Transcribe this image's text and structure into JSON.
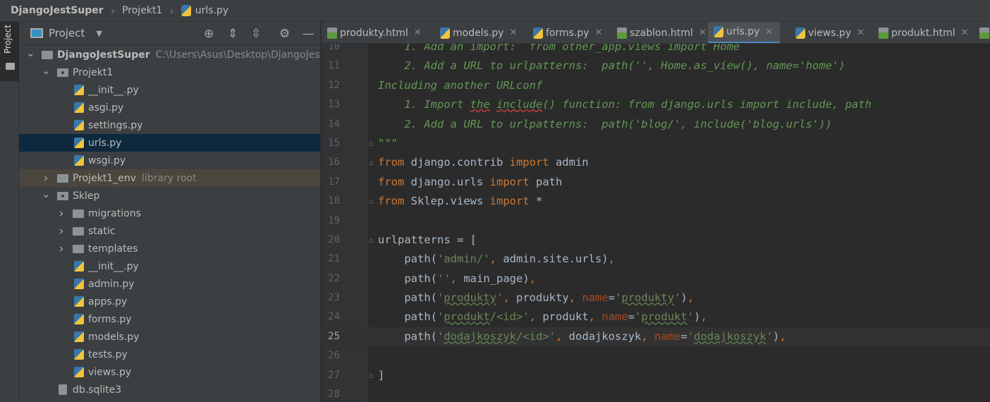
{
  "breadcrumb": [
    "DjangoJestSuper",
    "Projekt1",
    "urls.py"
  ],
  "sidebar_strip": {
    "label": "Project"
  },
  "panel": {
    "title": "Project",
    "toolbar": [
      "locate-icon",
      "expand-all-icon",
      "collapse-all-icon",
      "gear-icon",
      "minimize-icon"
    ]
  },
  "tree": [
    {
      "level": 0,
      "type": "folder",
      "expanded": true,
      "name": "DjangoJestSuper",
      "hint": "C:\\Users\\Asus\\Desktop\\DjangoJestSuper",
      "bold": true
    },
    {
      "level": 1,
      "type": "package",
      "expanded": true,
      "name": "Projekt1"
    },
    {
      "level": 2,
      "type": "py",
      "name": "__init__.py"
    },
    {
      "level": 2,
      "type": "py",
      "name": "asgi.py"
    },
    {
      "level": 2,
      "type": "py",
      "name": "settings.py"
    },
    {
      "level": 2,
      "type": "py",
      "name": "urls.py",
      "selected": true
    },
    {
      "level": 2,
      "type": "py",
      "name": "wsgi.py"
    },
    {
      "level": 1,
      "type": "folder",
      "expanded": false,
      "name": "Projekt1_env",
      "hint": "library root",
      "library": true
    },
    {
      "level": 1,
      "type": "package",
      "expanded": true,
      "name": "Sklep"
    },
    {
      "level": 2,
      "type": "folder",
      "expanded": false,
      "name": "migrations"
    },
    {
      "level": 2,
      "type": "folder",
      "expanded": false,
      "name": "static"
    },
    {
      "level": 2,
      "type": "folder",
      "expanded": false,
      "name": "templates"
    },
    {
      "level": 2,
      "type": "py",
      "name": "__init__.py"
    },
    {
      "level": 2,
      "type": "py",
      "name": "admin.py"
    },
    {
      "level": 2,
      "type": "py",
      "name": "apps.py"
    },
    {
      "level": 2,
      "type": "py",
      "name": "forms.py"
    },
    {
      "level": 2,
      "type": "py",
      "name": "models.py"
    },
    {
      "level": 2,
      "type": "py",
      "name": "tests.py"
    },
    {
      "level": 2,
      "type": "py",
      "name": "views.py"
    },
    {
      "level": 1,
      "type": "db",
      "name": "db.sqlite3"
    }
  ],
  "tabs": [
    {
      "name": "produkty.html",
      "type": "html"
    },
    {
      "name": "models.py",
      "type": "py"
    },
    {
      "name": "forms.py",
      "type": "py"
    },
    {
      "name": "szablon.html",
      "type": "html"
    },
    {
      "name": "urls.py",
      "type": "py",
      "active": true
    },
    {
      "name": "views.py",
      "type": "py"
    },
    {
      "name": "produkt.html",
      "type": "html"
    },
    {
      "name": "",
      "type": "html"
    }
  ],
  "editor": {
    "current_line": 25,
    "lines": [
      {
        "n": 10,
        "tokens": [
          [
            "doc",
            "    1. Add an import:  from other_app.views import Home"
          ]
        ]
      },
      {
        "n": 11,
        "tokens": [
          [
            "doc",
            "    2. Add a URL to urlpatterns:  path('', Home.as_view(), name='home')"
          ]
        ]
      },
      {
        "n": 12,
        "tokens": [
          [
            "doc",
            "Including another URLconf"
          ]
        ]
      },
      {
        "n": 13,
        "tokens": [
          [
            "doc",
            "    1. Import "
          ],
          [
            "doc err",
            "the"
          ],
          [
            "doc",
            " "
          ],
          [
            "doc err",
            "include"
          ],
          [
            "doc",
            "() function: from django.urls import include, path"
          ]
        ]
      },
      {
        "n": 14,
        "tokens": [
          [
            "doc",
            "    2. Add a URL to urlpatterns:  path('blog/', include('blog.urls'))"
          ]
        ]
      },
      {
        "n": 15,
        "fold": true,
        "tokens": [
          [
            "doc",
            "\"\"\""
          ]
        ]
      },
      {
        "n": 16,
        "fold": true,
        "tokens": [
          [
            "kw",
            "from"
          ],
          [
            "plain",
            " django.contrib "
          ],
          [
            "kw",
            "import"
          ],
          [
            "plain",
            " admin"
          ]
        ]
      },
      {
        "n": 17,
        "tokens": [
          [
            "kw",
            "from"
          ],
          [
            "plain",
            " django.urls "
          ],
          [
            "kw",
            "import"
          ],
          [
            "plain",
            " path"
          ]
        ]
      },
      {
        "n": 18,
        "fold": true,
        "tokens": [
          [
            "kw",
            "from"
          ],
          [
            "plain",
            " Sklep.views "
          ],
          [
            "kw",
            "import"
          ],
          [
            "plain",
            " *"
          ]
        ]
      },
      {
        "n": 19,
        "tokens": []
      },
      {
        "n": 20,
        "fold": true,
        "tokens": [
          [
            "plain",
            "urlpatterns = ["
          ]
        ]
      },
      {
        "n": 21,
        "tokens": [
          [
            "plain",
            "    path("
          ],
          [
            "str",
            "'admin/'"
          ],
          [
            "punc",
            ","
          ],
          [
            "plain",
            " admin.site.urls)"
          ],
          [
            "punc",
            ","
          ]
        ]
      },
      {
        "n": 22,
        "tokens": [
          [
            "plain",
            "    path("
          ],
          [
            "str",
            "''"
          ],
          [
            "punc",
            ","
          ],
          [
            "plain",
            " main_page)"
          ],
          [
            "punc",
            ","
          ]
        ]
      },
      {
        "n": 23,
        "tokens": [
          [
            "plain",
            "    path("
          ],
          [
            "str",
            "'"
          ],
          [
            "str typo",
            "produkty"
          ],
          [
            "str",
            "'"
          ],
          [
            "punc",
            ","
          ],
          [
            "plain",
            " produkty"
          ],
          [
            "punc",
            ","
          ],
          [
            "plain",
            " "
          ],
          [
            "param",
            "name"
          ],
          [
            "plain",
            "="
          ],
          [
            "str",
            "'"
          ],
          [
            "str typo",
            "produkty"
          ],
          [
            "str",
            "'"
          ],
          [
            "plain",
            ")"
          ],
          [
            "punc",
            ","
          ]
        ]
      },
      {
        "n": 24,
        "tokens": [
          [
            "plain",
            "    path("
          ],
          [
            "str",
            "'"
          ],
          [
            "str typo",
            "produkt"
          ],
          [
            "str",
            "/<id>'"
          ],
          [
            "punc",
            ","
          ],
          [
            "plain",
            " produkt"
          ],
          [
            "punc",
            ","
          ],
          [
            "plain",
            " "
          ],
          [
            "param",
            "name"
          ],
          [
            "plain",
            "="
          ],
          [
            "str",
            "'"
          ],
          [
            "str typo",
            "produkt"
          ],
          [
            "str",
            "'"
          ],
          [
            "plain",
            ")"
          ],
          [
            "punc",
            ","
          ]
        ]
      },
      {
        "n": 25,
        "tokens": [
          [
            "plain",
            "    path("
          ],
          [
            "str",
            "'"
          ],
          [
            "str typo",
            "dodajkoszyk"
          ],
          [
            "str",
            "/<id>'"
          ],
          [
            "punc",
            ","
          ],
          [
            "plain",
            " dodajkoszyk"
          ],
          [
            "punc",
            ","
          ],
          [
            "plain",
            " "
          ],
          [
            "param",
            "name"
          ],
          [
            "plain",
            "="
          ],
          [
            "str",
            "'"
          ],
          [
            "str typo",
            "dodajkoszyk"
          ],
          [
            "str",
            "'"
          ],
          [
            "plain",
            ")"
          ],
          [
            "punc",
            ","
          ]
        ]
      },
      {
        "n": 26,
        "tokens": []
      },
      {
        "n": 27,
        "fold": true,
        "tokens": [
          [
            "plain",
            "]"
          ]
        ]
      },
      {
        "n": 28,
        "tokens": []
      }
    ]
  }
}
